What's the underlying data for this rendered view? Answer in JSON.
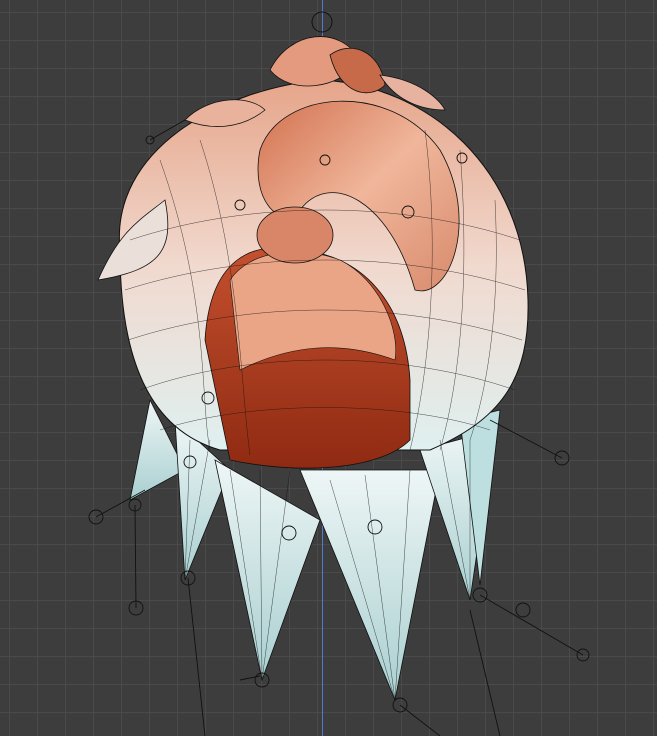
{
  "viewport": {
    "background": "#3d3d3d",
    "grid_color": "#4a4a4a",
    "axis_color": "#4f7bd0"
  },
  "model": {
    "hair_light": "#e6a58a",
    "hair_mid": "#d2714f",
    "hair_dark": "#a8321a",
    "skirt_light": "#d6ecec",
    "skirt_mid": "#a9cfd0",
    "wire_color": "#111111"
  },
  "icons": {
    "bone": "bone-joint-icon",
    "origin": "origin-marker-icon"
  }
}
